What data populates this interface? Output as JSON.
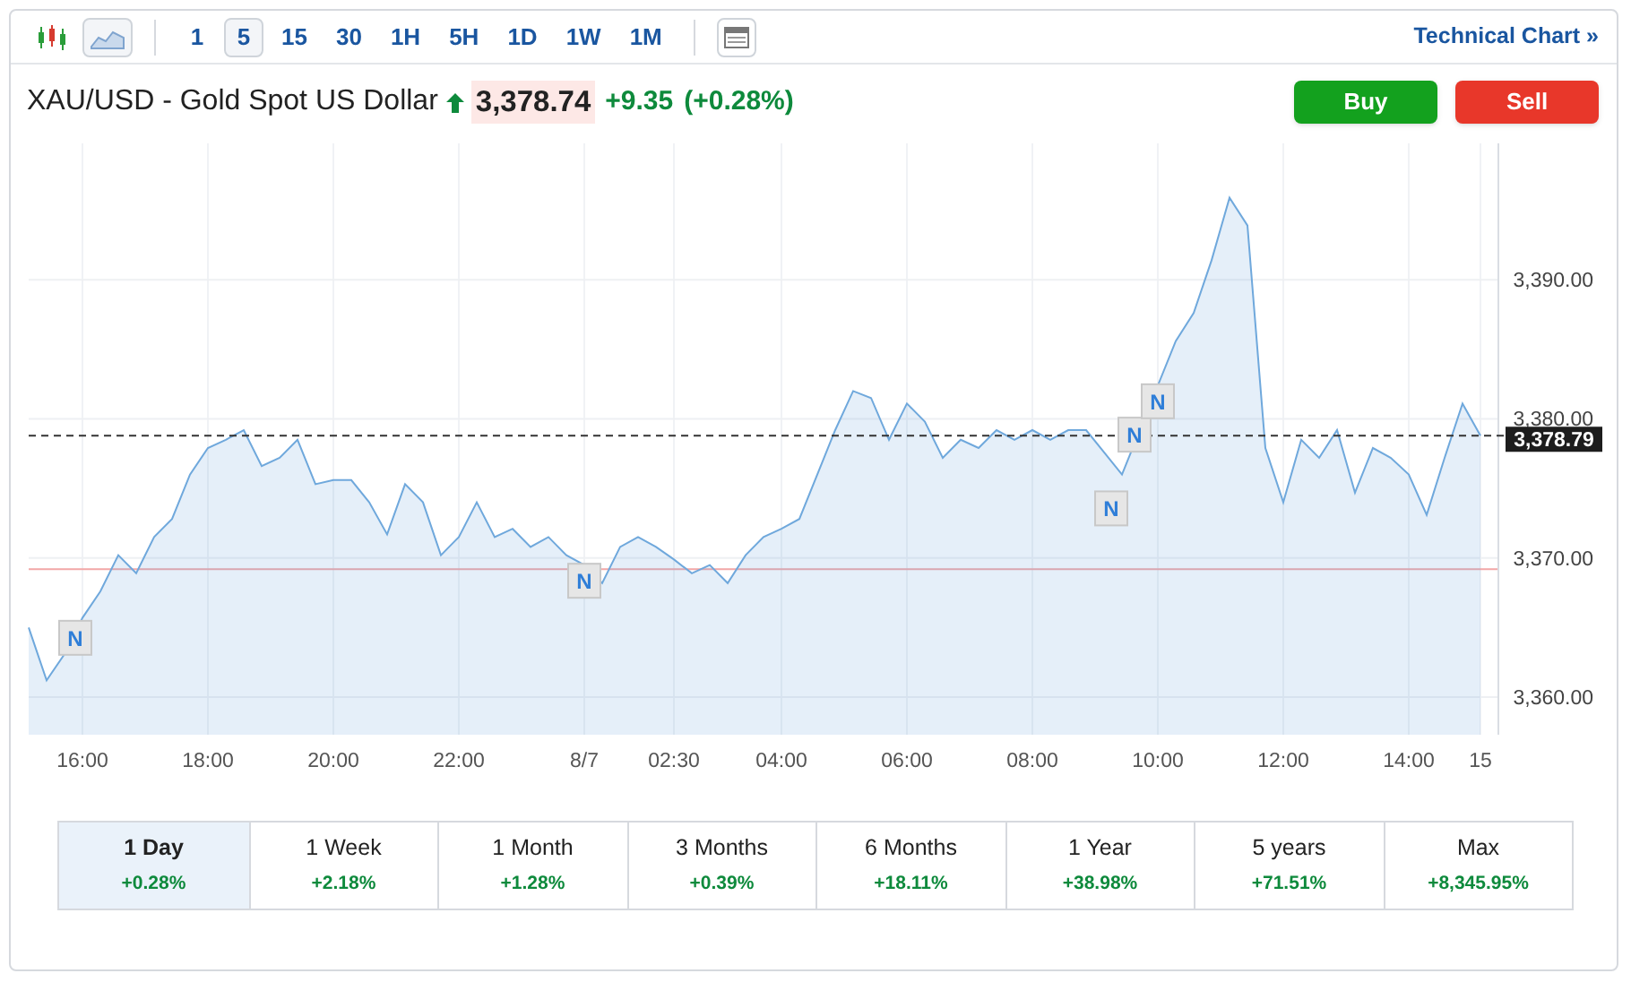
{
  "toolbar": {
    "chart_types": [
      {
        "kind": "candlestick",
        "selected": false
      },
      {
        "kind": "area",
        "selected": true
      }
    ],
    "intervals": [
      {
        "label": "1",
        "selected": false
      },
      {
        "label": "5",
        "selected": true
      },
      {
        "label": "15",
        "selected": false
      },
      {
        "label": "30",
        "selected": false
      },
      {
        "label": "1H",
        "selected": false
      },
      {
        "label": "5H",
        "selected": false
      },
      {
        "label": "1D",
        "selected": false
      },
      {
        "label": "1W",
        "selected": false
      },
      {
        "label": "1M",
        "selected": false
      }
    ],
    "link": "Technical Chart »"
  },
  "quote": {
    "name": "XAU/USD - Gold Spot US Dollar",
    "price": "3,378.74",
    "change": "+9.35",
    "change_percent": "(+0.28%)"
  },
  "actions": [
    "Buy",
    "Sell"
  ],
  "chart_data": {
    "type": "area",
    "categories": [
      null,
      null,
      null,
      "16:00",
      null,
      null,
      null,
      null,
      null,
      null,
      "18:00",
      null,
      null,
      null,
      null,
      null,
      null,
      "20:00",
      null,
      null,
      null,
      null,
      null,
      null,
      "22:00",
      null,
      null,
      null,
      null,
      null,
      null,
      "8/7",
      null,
      null,
      null,
      null,
      "02:30",
      null,
      null,
      null,
      null,
      null,
      "04:00",
      null,
      null,
      null,
      null,
      null,
      null,
      "06:00",
      null,
      null,
      null,
      null,
      null,
      null,
      "08:00",
      null,
      null,
      null,
      null,
      null,
      null,
      "10:00",
      null,
      null,
      null,
      null,
      null,
      null,
      "12:00",
      null,
      null,
      null,
      null,
      null,
      null,
      "14:00",
      null,
      null,
      null,
      "15"
    ],
    "series": [
      {
        "color": "#6fa8dc",
        "values": [
          3365.0,
          3361.2,
          3363.1,
          3365.7,
          3367.6,
          3370.2,
          3368.9,
          3371.5,
          3372.8,
          3376.0,
          3377.9,
          3378.5,
          3379.2,
          3376.6,
          3377.2,
          3378.5,
          3375.3,
          3375.6,
          3375.6,
          3374.0,
          3371.7,
          3375.3,
          3374.0,
          3370.2,
          3371.5,
          3374.0,
          3371.5,
          3372.1,
          3370.8,
          3371.5,
          3370.2,
          3369.5,
          3368.2,
          3370.8,
          3371.5,
          3370.8,
          3369.9,
          3368.9,
          3369.5,
          3368.2,
          3370.2,
          3371.5,
          3372.1,
          3372.8,
          3376.0,
          3379.2,
          3382.0,
          3381.5,
          3378.5,
          3381.1,
          3379.8,
          3377.2,
          3378.5,
          3377.9,
          3379.2,
          3378.5,
          3379.2,
          3378.5,
          3379.2,
          3379.2,
          null,
          3376.0,
          null,
          null,
          3385.6,
          3387.6,
          3391.4,
          3395.9,
          3393.9,
          3377.9,
          3374.0,
          3378.5,
          3377.2,
          3379.2,
          3374.7,
          3377.9,
          3377.2,
          3376.0,
          3373.1,
          3377.2,
          3381.1,
          3378.8
        ]
      }
    ],
    "ylim": [
      3357.3,
      3399.8
    ],
    "grid": true,
    "ref_lines": [
      {
        "axis": "y",
        "value": 3369.2,
        "color": "#f2a7a7"
      },
      {
        "axis": "y",
        "value": 3378.79,
        "color": "#333333",
        "label": "3,378.79"
      }
    ],
    "yticks": [
      {
        "value": 3360,
        "label": "3,360.00"
      },
      {
        "value": 3370,
        "label": "3,370.00"
      },
      {
        "value": 3380,
        "label": "3,380.00"
      },
      {
        "value": 3390,
        "label": "3,390.00"
      }
    ]
  },
  "news_markers": [
    "N",
    "N",
    "N",
    "N",
    "N"
  ],
  "periods": [
    {
      "label": "1 Day",
      "change": "+0.28%",
      "selected": true
    },
    {
      "label": "1 Week",
      "change": "+2.18%",
      "selected": false
    },
    {
      "label": "1 Month",
      "change": "+1.28%",
      "selected": false
    },
    {
      "label": "3 Months",
      "change": "+0.39%",
      "selected": false
    },
    {
      "label": "6 Months",
      "change": "+18.11%",
      "selected": false
    },
    {
      "label": "1 Year",
      "change": "+38.98%",
      "selected": false
    },
    {
      "label": "5 years",
      "change": "+71.51%",
      "selected": false
    },
    {
      "label": "Max",
      "change": "+8,345.95%",
      "selected": false
    }
  ]
}
